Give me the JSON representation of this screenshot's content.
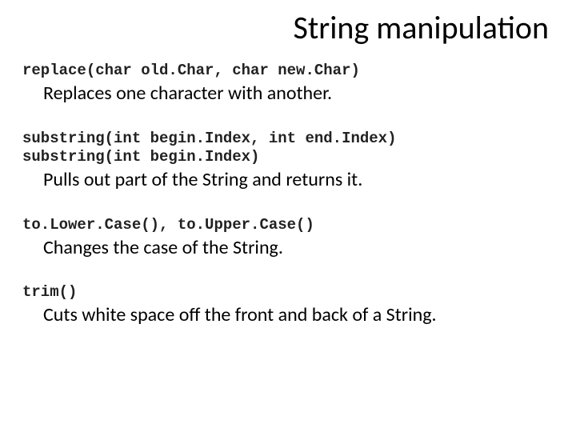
{
  "title": "String manipulation",
  "sections": [
    {
      "codeLines": [
        "replace(char old.Char, char new.Char)"
      ],
      "desc": "Replaces one character with another."
    },
    {
      "codeLines": [
        "substring(int begin.Index, int end.Index)",
        "substring(int begin.Index)"
      ],
      "desc": "Pulls out part of the String and returns it."
    },
    {
      "codeLines": [
        "to.Lower.Case(), to.Upper.Case()"
      ],
      "desc": "Changes the case of the String."
    },
    {
      "codeLines": [
        "trim()"
      ],
      "desc": "Cuts white space off the front and back of a String."
    }
  ]
}
